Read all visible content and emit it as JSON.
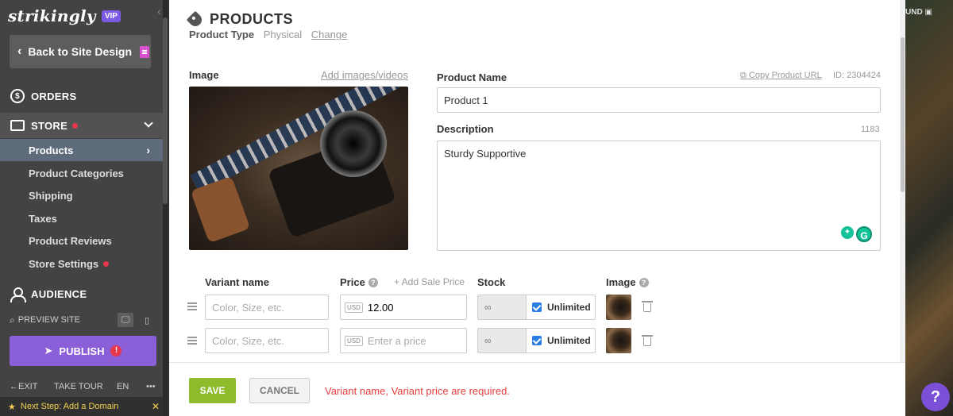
{
  "sidebar": {
    "logo": "strikingly",
    "vip": "VIP",
    "back_button": "Back to Site Design",
    "orders": "ORDERS",
    "orders_icon": "$",
    "store": "STORE",
    "store_items": [
      {
        "label": "Products"
      },
      {
        "label": "Product Categories"
      },
      {
        "label": "Shipping"
      },
      {
        "label": "Taxes"
      },
      {
        "label": "Product Reviews"
      },
      {
        "label": "Store Settings"
      }
    ],
    "audience": "AUDIENCE",
    "preview_site": "PREVIEW SITE",
    "publish": "PUBLISH",
    "exit": "EXIT",
    "take_tour": "TAKE TOUR",
    "language": "EN",
    "more": "•••",
    "next_step": "Next Step: Add a Domain"
  },
  "right_bg": {
    "partial_text": "UND"
  },
  "modal": {
    "title": "PRODUCTS",
    "product_type_label": "Product Type",
    "product_type_value": "Physical",
    "product_type_change": "Change",
    "image_label": "Image",
    "add_images_link": "Add images/videos",
    "product_name_label": "Product Name",
    "copy_url_link": "Copy Product URL",
    "product_id": "ID: 2304424",
    "product_name_value": "Product 1",
    "description_label": "Description",
    "description_count": "1183",
    "description_value": "Sturdy Supportive",
    "variants": {
      "col_name": "Variant name",
      "col_price": "Price",
      "add_sale_price": "+ Add Sale Price",
      "col_stock": "Stock",
      "col_image": "Image",
      "name_placeholder": "Color, Size, etc.",
      "price_placeholder": "Enter a price",
      "currency": "USD",
      "stock_infinity": "∞",
      "unlimited_label": "Unlimited",
      "rows": [
        {
          "name": "",
          "price": "12.00",
          "unlimited": true
        },
        {
          "name": "",
          "price": "",
          "unlimited": true
        }
      ]
    },
    "save_button": "SAVE",
    "cancel_button": "CANCEL",
    "error_message": "Variant name, Variant price are required."
  },
  "help_button": "?",
  "colors": {
    "sidebar_bg": "#434343",
    "publish": "#8b5fd8",
    "save": "#8dbb2c",
    "error": "#e43d3d",
    "active_item": "#5e6b7a"
  }
}
